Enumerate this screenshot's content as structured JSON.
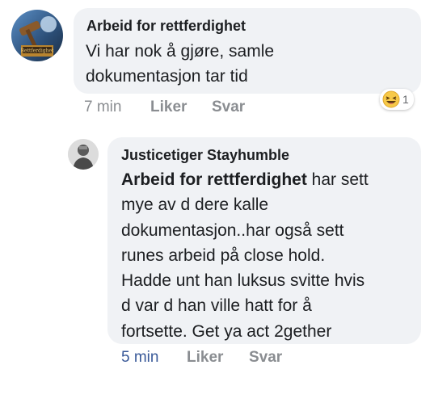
{
  "comment1": {
    "author": "Arbeid for rettferdighet",
    "lines": [
      "Vi har nok å gjøre, samle",
      "dokumentasjon tar tid"
    ],
    "time": "7 min",
    "like": "Liker",
    "reply": "Svar",
    "reaction": {
      "icon": "laughing-emoji",
      "count": "1"
    },
    "avatar_caption": "Rettferdighet"
  },
  "reply1": {
    "author": "Justicetiger Stayhumble",
    "mention": "Arbeid for rettferdighet",
    "first_line_rest": " har sett",
    "lines": [
      "mye av d dere kalle",
      "dokumentasjon..har også sett",
      "runes arbeid på close hold.",
      "Hadde unt han luksus svitte hvis",
      "d var d han ville hatt for å",
      "fortsette. Get ya act 2gether"
    ],
    "time": "5 min",
    "like": "Liker",
    "reply": "Svar"
  },
  "colors": {
    "bubble": "#f0f2f5",
    "text": "#1c1e21",
    "meta": "#8a8d91",
    "time_highlight": "#385898"
  }
}
